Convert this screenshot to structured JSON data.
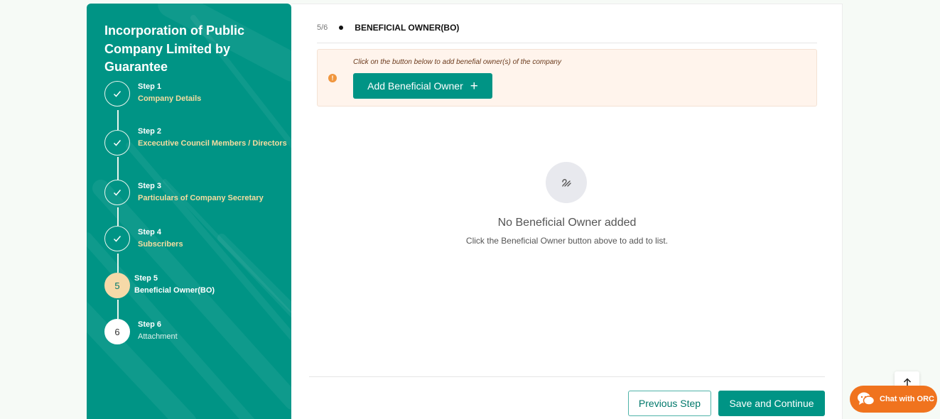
{
  "sidebar": {
    "title": "Incorporation of Public Company Limited by Guarantee",
    "steps": [
      {
        "num": "Step 1",
        "name": "Company Details",
        "state": "done"
      },
      {
        "num": "Step 2",
        "name": "Excecutive Council Members / Directors",
        "state": "done"
      },
      {
        "num": "Step 3",
        "name": "Particulars of Company Secretary",
        "state": "done"
      },
      {
        "num": "Step 4",
        "name": "Subscribers",
        "state": "done"
      },
      {
        "num": "Step 5",
        "name": "Beneficial Owner(BO)",
        "state": "current",
        "badge": "5"
      },
      {
        "num": "Step 6",
        "name": "Attachment",
        "state": "pending",
        "badge": "6"
      }
    ]
  },
  "main": {
    "progress": "5/6",
    "section_title": "BENEFICIAL OWNER(BO)",
    "alert": {
      "message": "Click on the button below to add benefial owner(s) of the company",
      "button": "Add Beneficial Owner"
    },
    "empty": {
      "title": "No Beneficial Owner added",
      "subtitle": "Click the Beneficial Owner button above to add to list."
    },
    "footer": {
      "previous": "Previous Step",
      "save": "Save and Continue"
    }
  },
  "chat": {
    "label": "Chat with ORC"
  },
  "colors": {
    "primary": "#009485",
    "accent": "#f6d9a8",
    "chat": "#f0731e",
    "alert_bg": "#fff4ec"
  }
}
